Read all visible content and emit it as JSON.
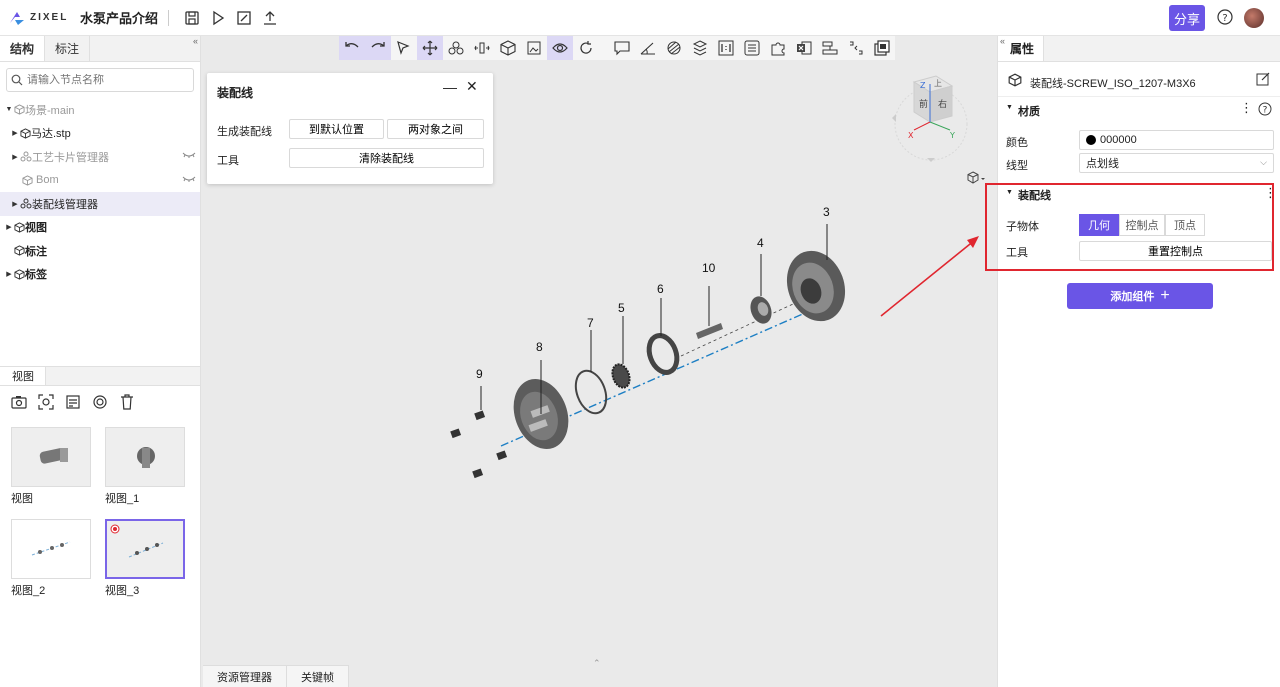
{
  "header": {
    "logo_text": "ZIXEL",
    "title": "水泵产品介绍",
    "share_label": "分享"
  },
  "left": {
    "tabs": [
      "结构",
      "标注"
    ],
    "search_placeholder": "请输入节点名称",
    "tree": [
      {
        "label": "场景-main"
      },
      {
        "label": "马达.stp"
      },
      {
        "label": "工艺卡片管理器"
      },
      {
        "label": "Bom"
      },
      {
        "label": "装配线管理器"
      },
      {
        "label": "视图"
      },
      {
        "label": "标注"
      },
      {
        "label": "标签"
      }
    ],
    "views_tab": "视图",
    "thumbnails": [
      "视图",
      "视图_1",
      "视图_2",
      "视图_3"
    ]
  },
  "canvas": {
    "part_labels": [
      "3",
      "4",
      "10",
      "6",
      "5",
      "7",
      "8",
      "9"
    ],
    "bottom_tabs": [
      "资源管理器",
      "关键帧"
    ],
    "viewcube": {
      "front": "前",
      "right": "右",
      "top": "上",
      "axis_x": "X",
      "axis_y": "Y",
      "axis_z": "Z"
    }
  },
  "dialog": {
    "title": "装配线",
    "generate_label": "生成装配线",
    "btn_default_pos": "到默认位置",
    "btn_between": "两对象之间",
    "tools_label": "工具",
    "btn_clear": "清除装配线"
  },
  "right": {
    "tab": "属性",
    "object_name": "装配线-SCREW_ISO_1207-M3X6",
    "material_head": "材质",
    "color_label": "颜色",
    "color_value": "000000",
    "linetype_label": "线型",
    "linetype_value": "点划线",
    "assembly_head": "装配线",
    "child_label": "子物体",
    "seg_options": [
      "几何",
      "控制点",
      "顶点"
    ],
    "tools_label": "工具",
    "reset_btn": "重置控制点",
    "add_btn": "添加组件"
  },
  "colors": {
    "accent": "#6a55e6",
    "highlight_red": "#e0262f",
    "assembly_line": "#1d7fc4"
  }
}
